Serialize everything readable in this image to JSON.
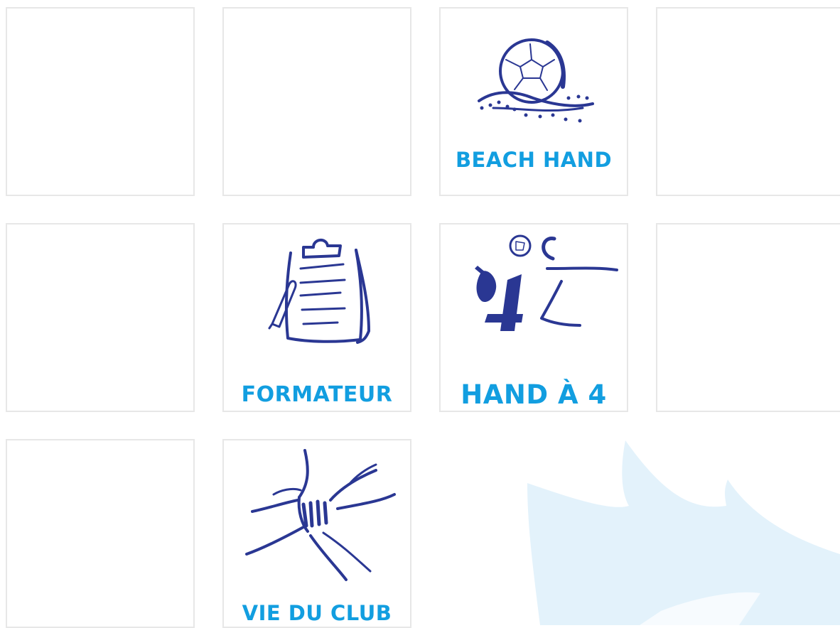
{
  "tiles": {
    "beach_hand": {
      "label": "BEACH HAND",
      "icon": "beach-ball-icon"
    },
    "formateur": {
      "label": "FORMATEUR",
      "icon": "clipboard-icon"
    },
    "hand_a_4": {
      "label": "HAND À 4",
      "icon": "handball-player-icon"
    },
    "vie_du_club": {
      "label": "VIE DU CLUB",
      "icon": "joined-hands-icon"
    }
  },
  "colors": {
    "label": "#129ee0",
    "icon": "#2a3793",
    "tile_border": "#e7e7e7",
    "watermark": "#e3f2fb"
  }
}
